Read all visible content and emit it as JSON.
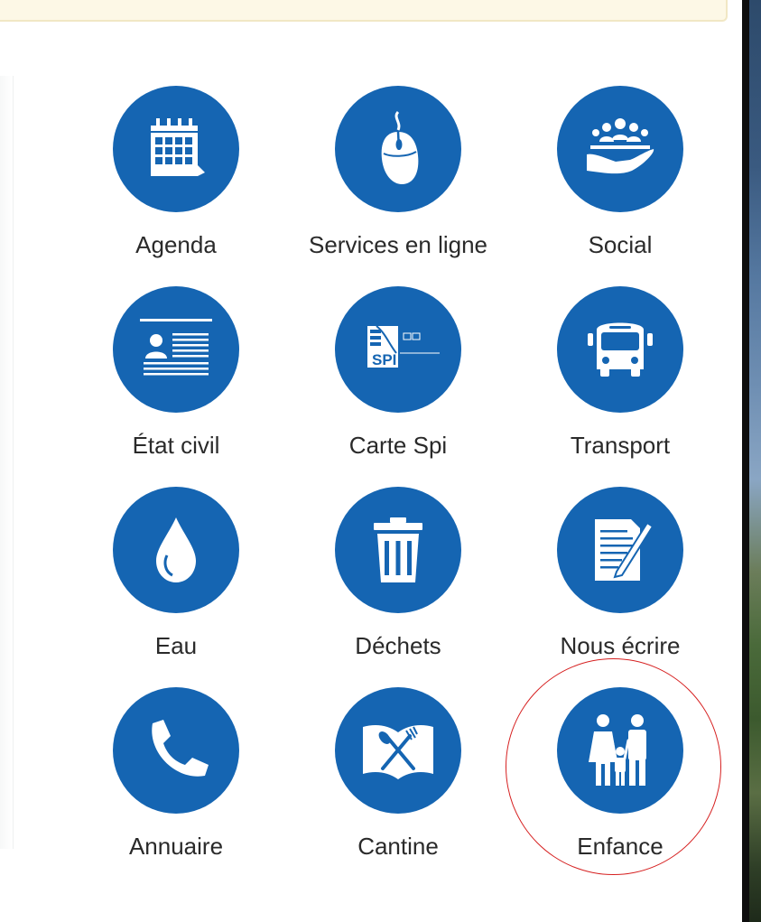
{
  "tiles": [
    {
      "label": "Agenda",
      "icon": "calendar-icon"
    },
    {
      "label": "Services en ligne",
      "icon": "mouse-icon"
    },
    {
      "label": "Social",
      "icon": "people-hand-icon"
    },
    {
      "label": "État civil",
      "icon": "id-card-icon"
    },
    {
      "label": "Carte Spi",
      "icon": "spi-card-icon",
      "icon_text": "SPI"
    },
    {
      "label": "Transport",
      "icon": "bus-icon"
    },
    {
      "label": "Eau",
      "icon": "water-drop-icon"
    },
    {
      "label": "Déchets",
      "icon": "trash-icon"
    },
    {
      "label": "Nous écrire",
      "icon": "document-pen-icon"
    },
    {
      "label": "Annuaire",
      "icon": "phone-icon"
    },
    {
      "label": "Cantine",
      "icon": "book-cutlery-icon"
    },
    {
      "label": "Enfance",
      "icon": "family-icon"
    }
  ],
  "colors": {
    "circle": "#1565b2",
    "label": "#2a2a2a",
    "highlight": "#d62020",
    "banner": "#fdf8e6"
  },
  "highlighted_tile": "Enfance"
}
